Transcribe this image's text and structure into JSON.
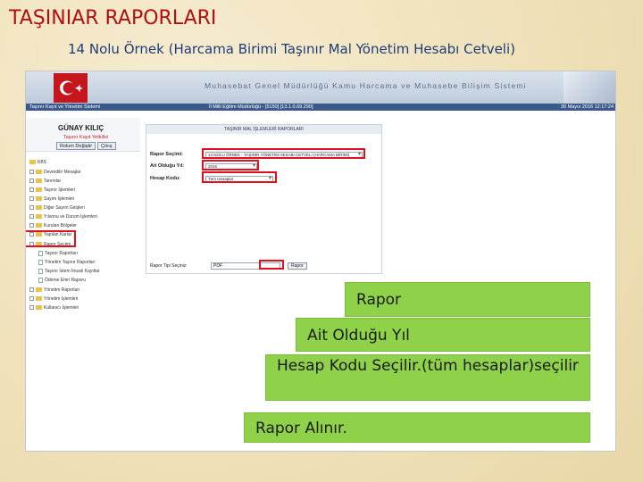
{
  "slide": {
    "title": "TAŞINIAR RAPORLARI",
    "subtitle": "14 Nolu Örnek (Harcama Birimi Taşınır Mal Yönetim Hesabı Cetveli)"
  },
  "app": {
    "banner_title": "Muhasebat Genel Müdürlüğü Kamu Harcama ve Muhasebe Bilişim Sistemi",
    "status_left": "Taşınır Kayıt ve Yönetim Sistemi",
    "status_center": "İl Milli Eğitim Müdürlüğü - [5150]  [13.1.0.69.290]",
    "status_right": "30 Mayıs 2016  12:17:24",
    "user": {
      "name": "GÜNAY KILIÇ",
      "role": "Taşınır Kayıt Yetkilisi",
      "change_role_label": "Rolum Değiştir",
      "logout_label": "Çıkış"
    },
    "tree": [
      {
        "label": "KBS",
        "type": "root"
      },
      {
        "label": "Devredilir Mesajlar",
        "type": "folder"
      },
      {
        "label": "Tanımlar",
        "type": "folder"
      },
      {
        "label": "Taşınır İşlemleri",
        "type": "folder"
      },
      {
        "label": "Sayım İşlemleri",
        "type": "folder"
      },
      {
        "label": "Diğer Sayım Girişleri",
        "type": "folder"
      },
      {
        "label": "Yılsonu ve Durum İşlemleri",
        "type": "folder"
      },
      {
        "label": "Kurulan Bölgeler",
        "type": "folder"
      },
      {
        "label": "Yapılan Karlar",
        "type": "folder"
      },
      {
        "label": "Rapor Seçimi",
        "type": "folder-open"
      },
      {
        "label": "Taşınır Raporları",
        "type": "doc-selected"
      },
      {
        "label": "Yönetim Taşınır Raporları",
        "type": "doc"
      },
      {
        "label": "Taşınır İstem İmzalı Kayıtlar",
        "type": "doc"
      },
      {
        "label": "Ödeme Emri Raporu",
        "type": "doc"
      },
      {
        "label": "Yönetim Raporları",
        "type": "folder"
      },
      {
        "label": "Yönetim İşlemleri",
        "type": "folder"
      },
      {
        "label": "Kullanıcı İşlemleri",
        "type": "folder"
      }
    ],
    "form": {
      "header": "TAŞINIR MAL İŞLEMLERİ RAPORLARI",
      "rapor_label": "Rapor Seçimi:",
      "rapor_value": "14 NOLU ÖRNEK - TAŞINIR YÖNETİM HESABI CETVELİ (HARCAMA BİRİMİ)",
      "yil_label": "Ait Olduğu Yıl:",
      "yil_value": "2016",
      "hesap_label": "Hesap Kodu:",
      "hesap_value": "Tüm Hesaplar",
      "rapor_tipi_label": "Rapor Tipi Seçiniz:",
      "rapor_tipi_value": "PDF",
      "rapor_button": "Rapor"
    }
  },
  "callouts": [
    "Rapor",
    "Ait Olduğu Yıl",
    "Hesap Kodu Seçilir.(tüm hesaplar)seçilir",
    "Rapor Alınır."
  ],
  "colors": {
    "title": "#b01010",
    "subtitle": "#1e3b7a",
    "highlight": "#e0101e",
    "callout": "#8fd24a"
  }
}
